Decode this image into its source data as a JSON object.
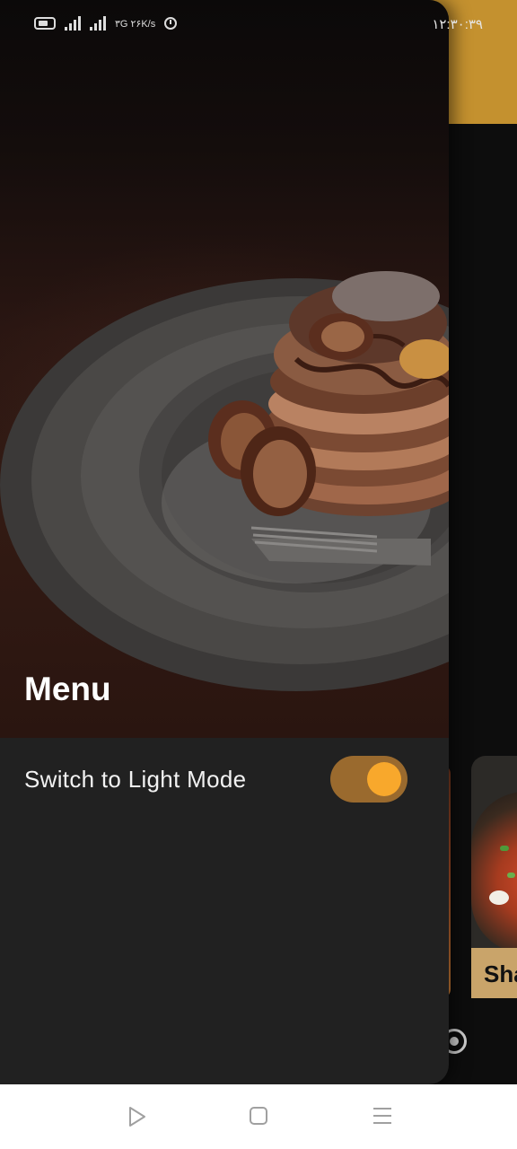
{
  "status_bar": {
    "time": "۱۲:۳۰:۳۹",
    "network_text": "۳G ۲۶K/s",
    "icons": [
      "battery-icon",
      "signal-icon",
      "signal-icon",
      "alarm-icon"
    ]
  },
  "drawer": {
    "title": "Menu",
    "header_image": "pancake-stack-with-figs-photo",
    "items": [
      {
        "label": "Switch to Light Mode",
        "control": "toggle",
        "checked": true
      }
    ]
  },
  "background_app": {
    "visible_card_text": "Sha"
  },
  "nav_bar": {
    "icons": [
      "back-icon",
      "home-icon",
      "recents-icon"
    ]
  },
  "colors": {
    "accent": "#f8a82c",
    "toggle_track": "#9a6a2e",
    "app_bar": "#c4912f",
    "drawer_bg": "#212121"
  }
}
